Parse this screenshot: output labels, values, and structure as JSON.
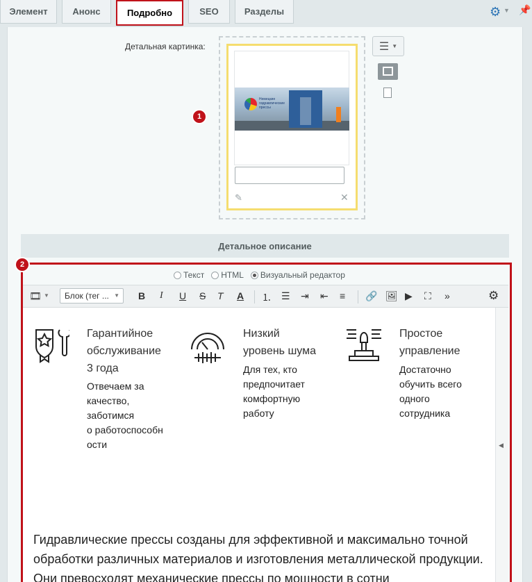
{
  "tabs": [
    {
      "label": "Элемент",
      "active": false
    },
    {
      "label": "Анонс",
      "active": false
    },
    {
      "label": "Подробно",
      "active": true
    },
    {
      "label": "SEO",
      "active": false
    },
    {
      "label": "Разделы",
      "active": false
    }
  ],
  "detail_image": {
    "label": "Детальная картинка:",
    "preview_logo_text": "Немецкие гидравлические прессы",
    "description_value": ""
  },
  "badges": {
    "image": "1",
    "editor": "2"
  },
  "section": {
    "title": "Детальное описание"
  },
  "editor": {
    "modes": [
      {
        "label": "Текст",
        "checked": false
      },
      {
        "label": "HTML",
        "checked": false
      },
      {
        "label": "Визуальный редактор",
        "checked": true
      }
    ],
    "block_select": "Блок (тег ...",
    "toolbar_icons": [
      "film-icon",
      "bold-icon",
      "italic-icon",
      "underline-icon",
      "strikethrough-icon",
      "clear-format-icon",
      "text-color-icon",
      "ordered-list-icon",
      "bullet-list-icon",
      "indent-icon",
      "outdent-icon",
      "align-icon",
      "link-icon",
      "image-icon",
      "video-icon",
      "fullscreen-icon",
      "more-icon",
      "settings-icon"
    ],
    "toolbar_glyphs": {
      "bold": "B",
      "italic": "I",
      "underline": "U",
      "strike": "S",
      "clear": "T",
      "text_color": "A",
      "more": "»"
    }
  },
  "features": [
    {
      "icon": "warranty-icon",
      "title": [
        "Гарантийное",
        "обслуживание",
        "3 года"
      ],
      "text": [
        "Отвечаем за",
        "качество,",
        "заботимся",
        "о работоспособн",
        "ости"
      ]
    },
    {
      "icon": "noise-gauge-icon",
      "title": [
        "Низкий",
        "уровень шума"
      ],
      "text": [
        "Для тех, кто",
        "предпочитает",
        "комфортную",
        "работу"
      ]
    },
    {
      "icon": "joystick-icon",
      "title": [
        "Простое",
        "управление"
      ],
      "text": [
        "Достаточно",
        "обучить всего",
        "одного",
        "сотрудника"
      ]
    }
  ],
  "body_text": "Гидравлические прессы созданы для эффективной и максимально точной обработки различных материалов и изготовления металлической продукции. Они превосходят механические прессы по мощности в сотни",
  "colors": {
    "accent_red": "#c0121a",
    "gear_blue": "#2d75b6",
    "image_border": "#f5dd6f"
  }
}
